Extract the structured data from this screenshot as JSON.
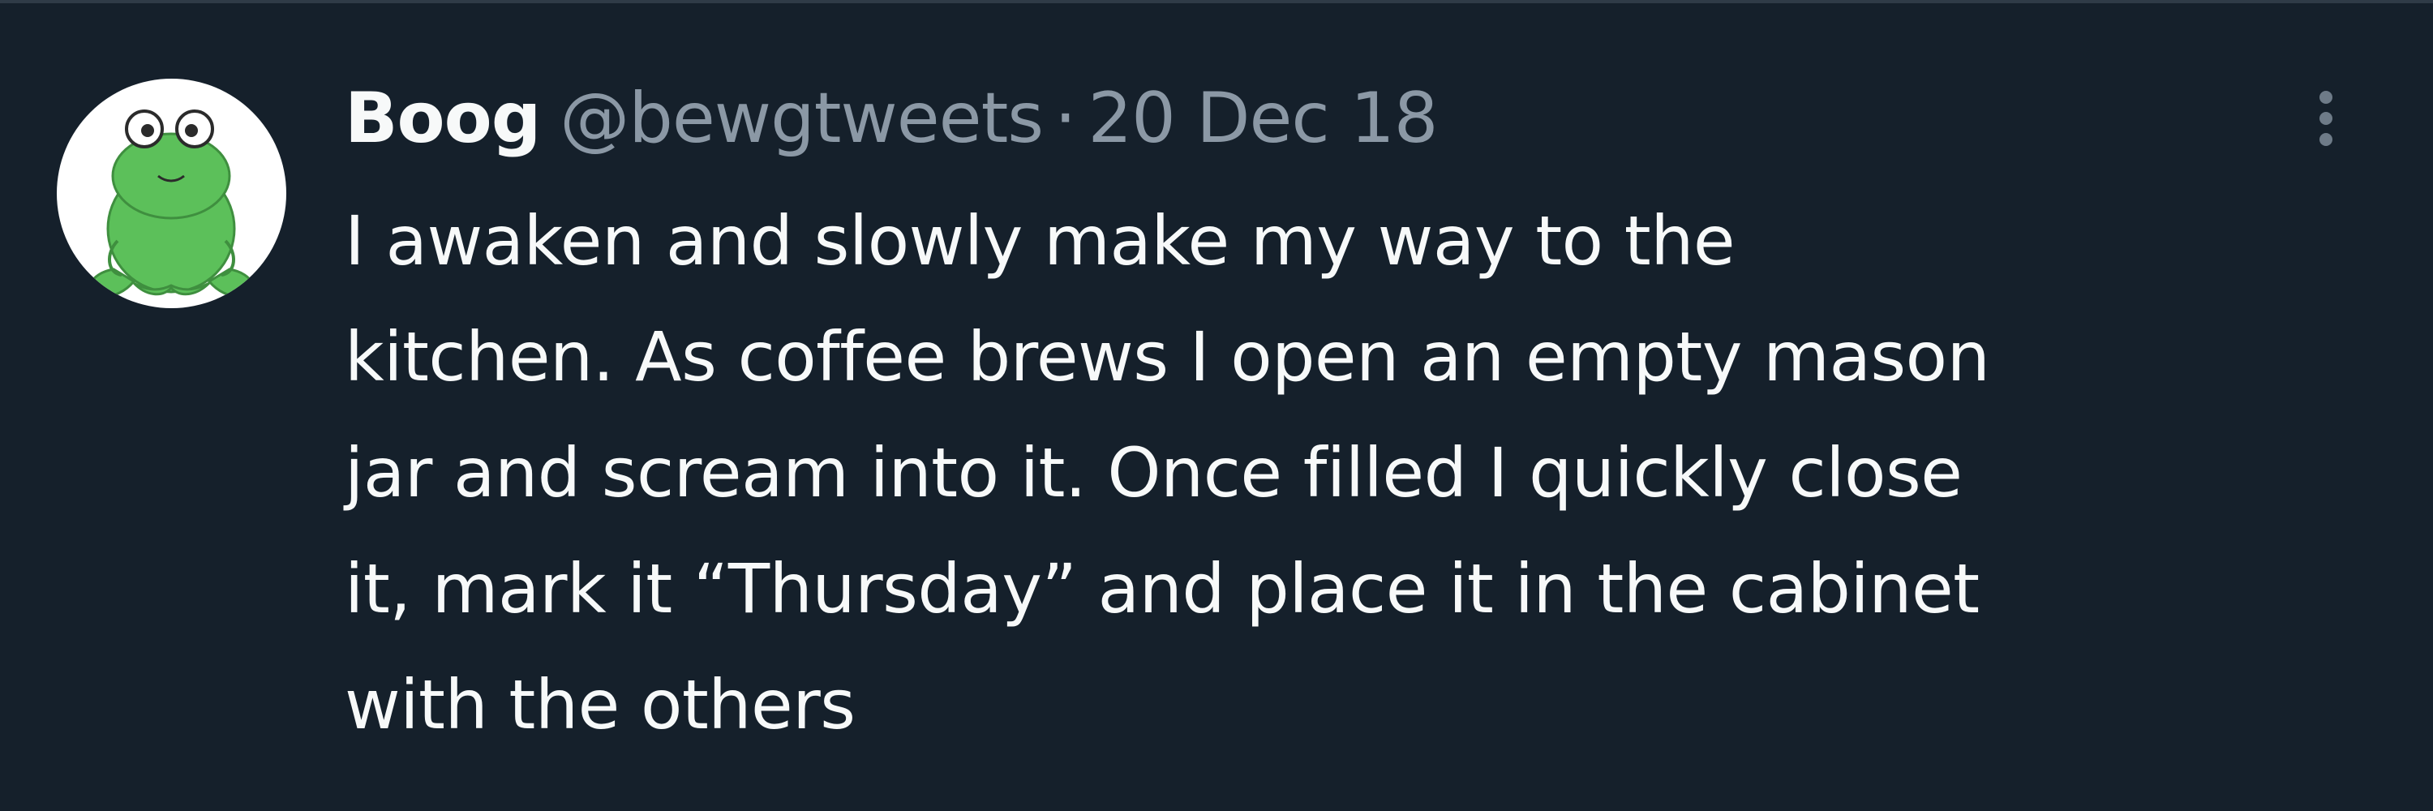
{
  "tweet": {
    "author_name": "Boog",
    "author_handle": "@bewgtweets",
    "separator": "·",
    "date": "20 Dec 18",
    "more_icon": "more-vertical-icon",
    "avatar_icon": "frog-avatar",
    "text_lines": [
      "I awaken and slowly make my way to the",
      "kitchen. As coffee brews I open an empty mason",
      "jar and scream into it. Once filled I quickly close",
      "it, mark it “Thursday” and place it in the cabinet",
      "with the others"
    ]
  },
  "colors": {
    "background": "#15202b",
    "text_primary": "#f7f9f9",
    "text_secondary": "#8b98a5",
    "avatar_frog": "#5cc05a"
  }
}
